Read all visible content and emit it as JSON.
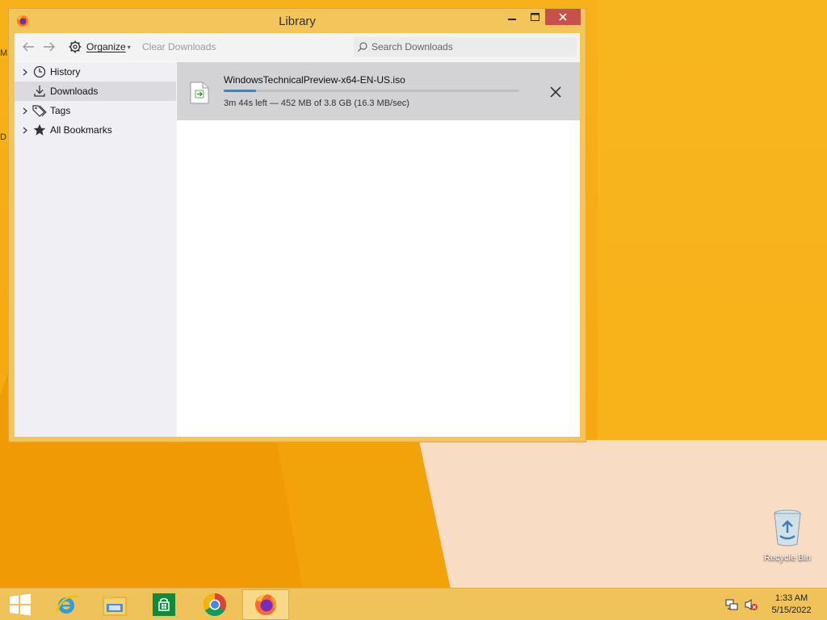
{
  "window": {
    "title": "Library",
    "accent_color": "#f4c55a",
    "close_button_color": "#c7504c"
  },
  "toolbar": {
    "back_icon": "arrow-left-icon",
    "forward_icon": "arrow-right-icon",
    "organize_label": "Organize",
    "clear_downloads_label": "Clear Downloads",
    "search_placeholder": "Search Downloads"
  },
  "sidebar": {
    "items": [
      {
        "label": "History",
        "icon": "clock-icon",
        "expandable": true,
        "selected": false
      },
      {
        "label": "Downloads",
        "icon": "download-icon",
        "expandable": false,
        "selected": true
      },
      {
        "label": "Tags",
        "icon": "tags-icon",
        "expandable": true,
        "selected": false
      },
      {
        "label": "All Bookmarks",
        "icon": "star-icon",
        "expandable": true,
        "selected": false
      }
    ]
  },
  "downloads": [
    {
      "filename": "WindowsTechnicalPreview-x64-EN-US.iso",
      "status": "3m 44s left — 452 MB of 3.8 GB (16.3 MB/sec)",
      "progress": 0.11,
      "progress_color": "#2a8ad4"
    }
  ],
  "desktop": {
    "recycle_bin_label": "Recycle Bin",
    "edge_letters": [
      "M",
      "D"
    ]
  },
  "taskbar": {
    "apps": [
      "start-icon",
      "internet-explorer-icon",
      "file-explorer-icon",
      "store-icon",
      "chrome-icon",
      "firefox-icon"
    ],
    "active_app": "firefox-icon"
  },
  "clock": {
    "time": "1:33 AM",
    "date": "5/15/2022"
  }
}
